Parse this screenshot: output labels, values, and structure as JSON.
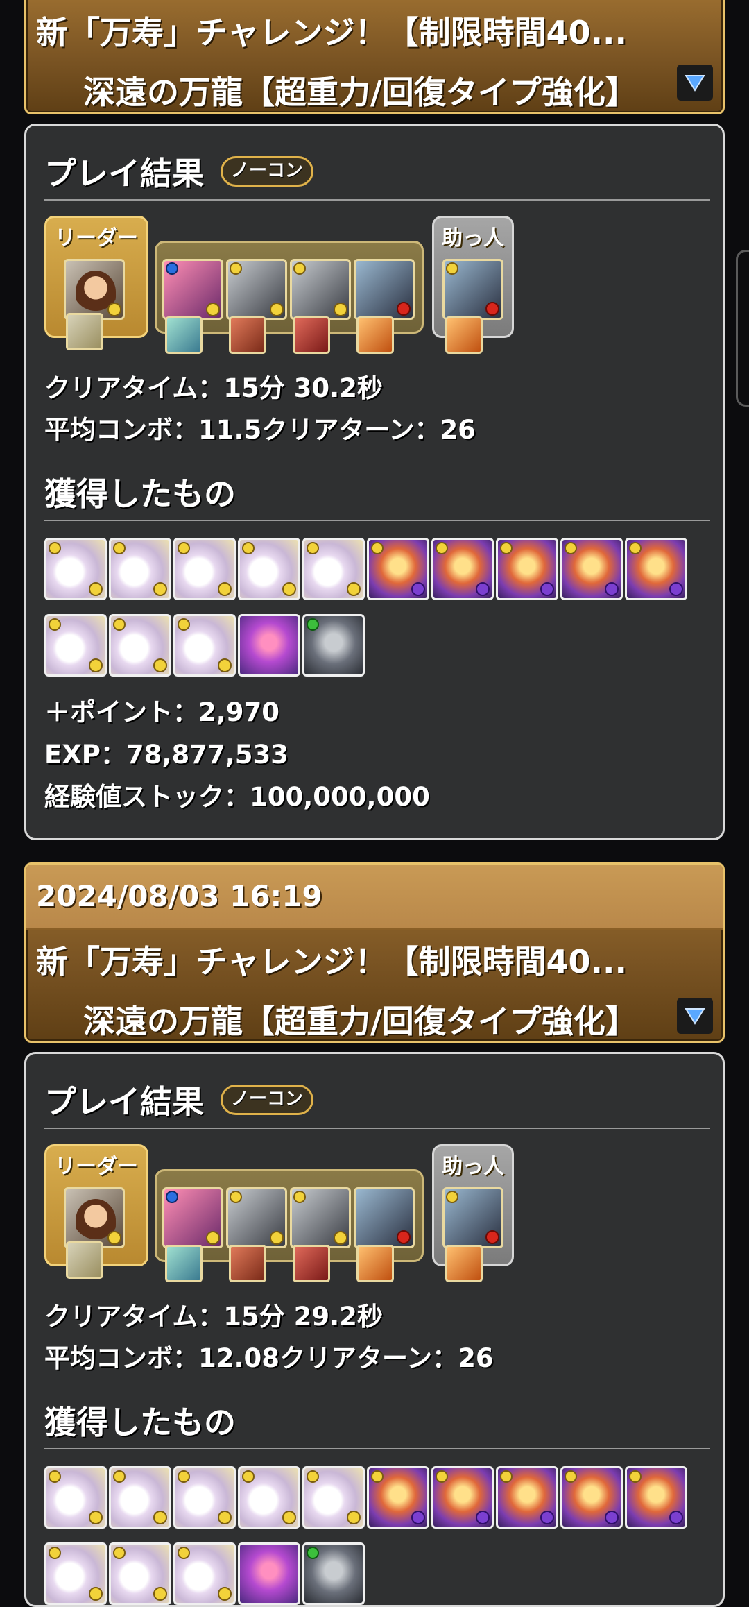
{
  "entry1": {
    "date": "",
    "dungeon_title": "新「万寿」チャレンジ！【制限時間40...",
    "floor_title": "深遠の万龍【超重力/回復タイプ強化】",
    "result_heading": "プレイ結果",
    "badge": "ノーコン",
    "leader_label": "リーダー",
    "helper_label": "助っ人",
    "clear_time": "クリアタイム：15分 30.2秒",
    "combo_turn": "平均コンボ：11.5クリアターン：26",
    "rewards_heading": "獲得したもの",
    "plus_points": "＋ポイント：2,970",
    "exp": "EXP：78,877,533",
    "exp_stock": "経験値ストック：100,000,000"
  },
  "entry2": {
    "date": "2024/08/03 16:19",
    "dungeon_title": "新「万寿」チャレンジ！【制限時間40...",
    "floor_title": "深遠の万龍【超重力/回復タイプ強化】",
    "result_heading": "プレイ結果",
    "badge": "ノーコン",
    "leader_label": "リーダー",
    "helper_label": "助っ人",
    "clear_time": "クリアタイム：15分 29.2秒",
    "combo_turn": "平均コンボ：12.08クリアターン：26",
    "rewards_heading": "獲得したもの"
  },
  "icons": {
    "dropdown": "triangle-down-icon"
  },
  "colors": {
    "banner": "#7a5423",
    "banner_border": "#e8c26a",
    "card_bg": "#2f3031",
    "card_border": "#d9d9d9"
  }
}
